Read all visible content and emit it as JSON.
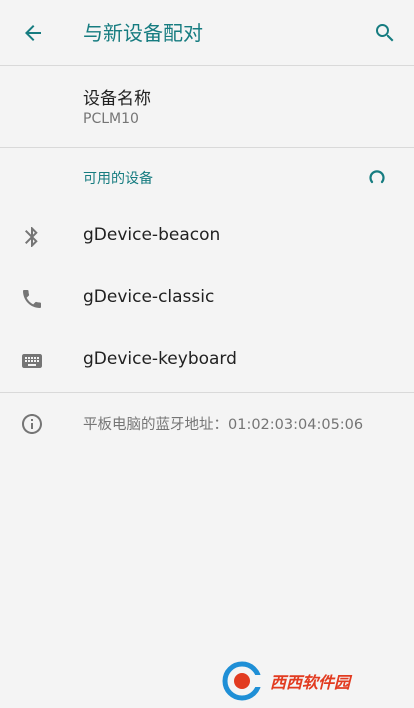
{
  "appbar": {
    "title": "与新设备配对",
    "back_icon": "arrow-back-icon",
    "search_icon": "search-icon",
    "accent_color": "#167c80"
  },
  "device_name": {
    "label": "设备名称",
    "value": "PCLM10"
  },
  "available": {
    "header": "可用的设备",
    "devices": [
      {
        "name": "gDevice-beacon",
        "icon": "bluetooth-icon"
      },
      {
        "name": "gDevice-classic",
        "icon": "phone-icon"
      },
      {
        "name": "gDevice-keyboard",
        "icon": "keyboard-icon"
      }
    ]
  },
  "info": {
    "text": "平板电脑的蓝牙地址：01:02:03:04:05:06",
    "icon": "info-icon"
  },
  "watermark": {
    "text": "西西软件园"
  }
}
